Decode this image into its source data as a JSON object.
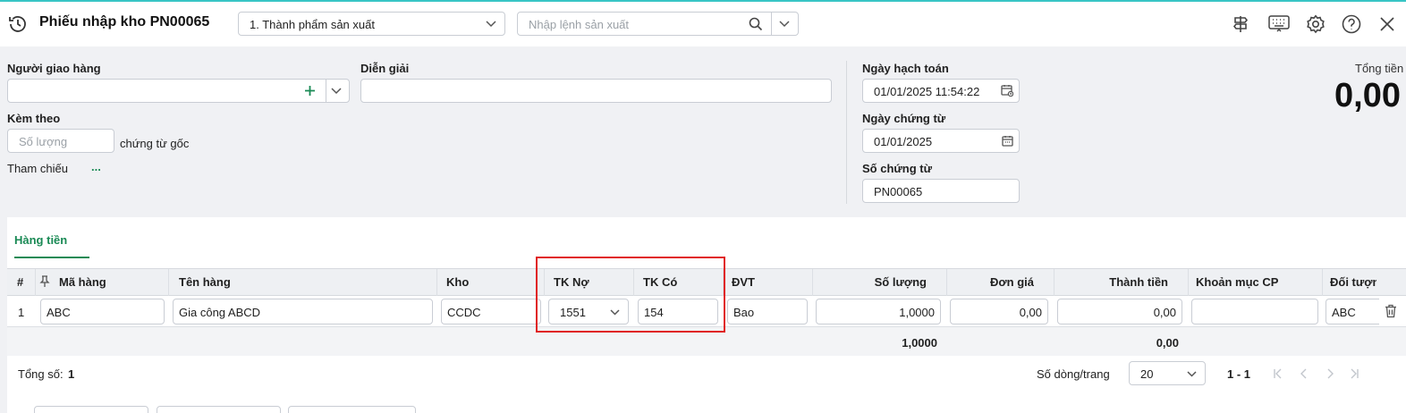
{
  "header": {
    "title": "Phiếu nhập kho PN00065",
    "type_select": "1. Thành phẩm sản xuất",
    "production_order_placeholder": "Nhập lệnh sản xuất",
    "icons": [
      "history-icon",
      "signpost-icon",
      "keyboard-icon",
      "gear-icon",
      "help-icon",
      "close-icon"
    ]
  },
  "form": {
    "deliverer_label": "Người giao hàng",
    "deliverer_value": "",
    "description_label": "Diễn giải",
    "description_value": "",
    "attach_label": "Kèm theo",
    "attach_placeholder": "Số lượng",
    "attach_suffix": "chứng từ gốc",
    "reference_label": "Tham chiếu",
    "reference_link": "...",
    "posting_date_label": "Ngày hạch toán",
    "posting_date_value": "01/01/2025 11:54:22",
    "voucher_date_label": "Ngày chứng từ",
    "voucher_date_value": "01/01/2025",
    "voucher_no_label": "Số chứng từ",
    "voucher_no_value": "PN00065",
    "total_label": "Tổng tiền",
    "total_value": "0,00"
  },
  "tabs": [
    {
      "label": "Hàng tiền",
      "active": true
    }
  ],
  "table": {
    "columns": [
      "#",
      "Mã hàng",
      "Tên hàng",
      "Kho",
      "TK Nợ",
      "TK Có",
      "ĐVT",
      "Số lượng",
      "Đơn giá",
      "Thành tiền",
      "Khoản mục CP",
      "Đối tượng"
    ],
    "rows": [
      {
        "no": "1",
        "item_code": "ABC",
        "item_name": "Gia công ABCD",
        "warehouse": "CCDC",
        "debit_account": "1551",
        "credit_account": "154",
        "unit": "Bao",
        "quantity": "1,0000",
        "unit_price": "0,00",
        "amount": "0,00",
        "expense_item": "",
        "object": "ABC"
      }
    ],
    "totals": {
      "quantity": "1,0000",
      "amount": "0,00"
    }
  },
  "footer": {
    "total_count_label": "Tổng số:",
    "total_count": "1",
    "rows_per_page_label": "Số dòng/trang",
    "rows_per_page": "20",
    "page_range": "1 - 1"
  },
  "colors": {
    "accent_green": "#1a8a55",
    "highlight_red": "#e02020",
    "top_line": "#38c5c5"
  }
}
